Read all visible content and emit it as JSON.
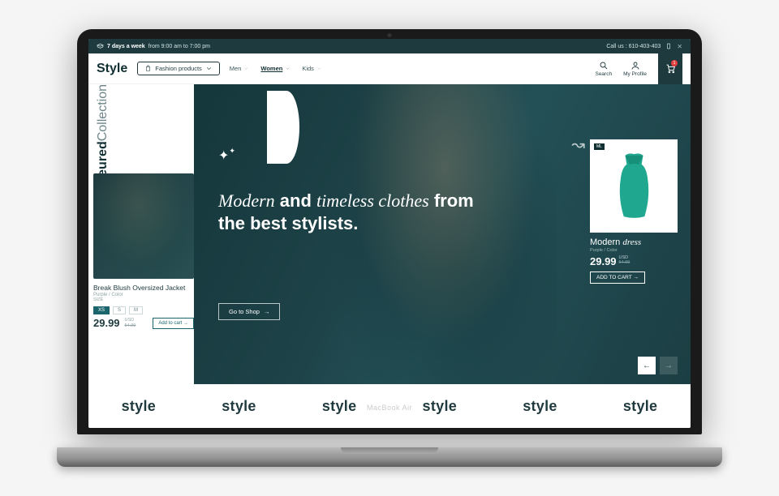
{
  "topbar": {
    "schedule_bold": "7 days a week",
    "schedule_rest": " from 9:00 am to 7:00 pm",
    "call_us": "Call us : 610-403-403"
  },
  "header": {
    "logo": "Style",
    "category_label": "Fashion products",
    "nav": {
      "men": "Men",
      "women": "Women",
      "kids": "Kids"
    },
    "search_label": "Search",
    "profile_label": "My Profile",
    "cart_count": "1"
  },
  "featured": {
    "bold": "Feateured",
    "light": "Collection"
  },
  "side_product": {
    "title": "Break Blush Oversized Jacket",
    "meta": "Purple / Color",
    "size_label": "SIZE",
    "sizes": {
      "xs": "XS",
      "s": "S",
      "m": "M"
    },
    "price": "29.99",
    "currency": "USD",
    "old": "54.99",
    "add": "Add to cart"
  },
  "hero": {
    "m": "Modern",
    "and": " and ",
    "t": "timeless",
    "c": " clothes",
    "rest": " from the best stylists.",
    "shop": "Go to Shop"
  },
  "inset": {
    "badge": "ML",
    "t1": "Modern ",
    "t2": "dress",
    "meta": "Purple / Color",
    "price": "29.99",
    "currency": "USD",
    "old": "54.99",
    "add": "ADD TO CART"
  },
  "marquee": {
    "t": "style"
  },
  "laptop": "MacBook Air"
}
